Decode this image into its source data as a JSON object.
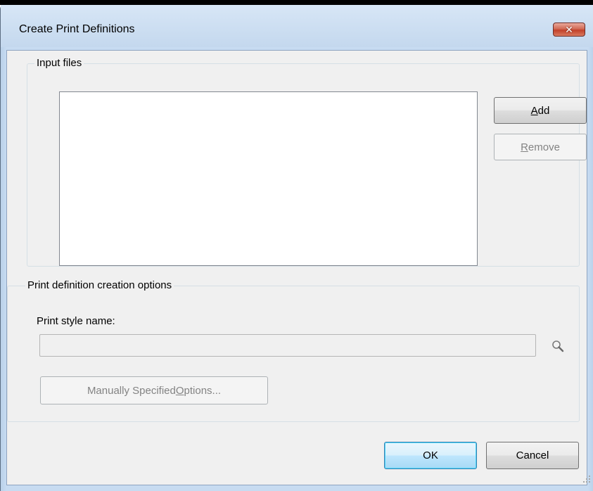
{
  "window": {
    "title": "Create Print Definitions",
    "close_glyph": "✕"
  },
  "input_files": {
    "group_label": "Input files",
    "files": [],
    "add": {
      "prefix": "",
      "accel": "A",
      "rest": "dd",
      "enabled": true
    },
    "remove": {
      "prefix": "",
      "accel": "R",
      "rest": "emove",
      "enabled": false
    }
  },
  "options": {
    "group_label": "Print definition creation options",
    "style_name_label": "Print style name:",
    "style_name_value": "",
    "search_icon": "magnifier-icon",
    "manual": {
      "prefix": "Manually Specified ",
      "accel": "O",
      "rest": "ptions...",
      "enabled": false
    }
  },
  "dialog_buttons": {
    "ok": "OK",
    "cancel": "Cancel"
  },
  "colors": {
    "close_button": "#c7432c",
    "default_button_border": "#3c7fb1",
    "disabled_text": "#838383"
  }
}
